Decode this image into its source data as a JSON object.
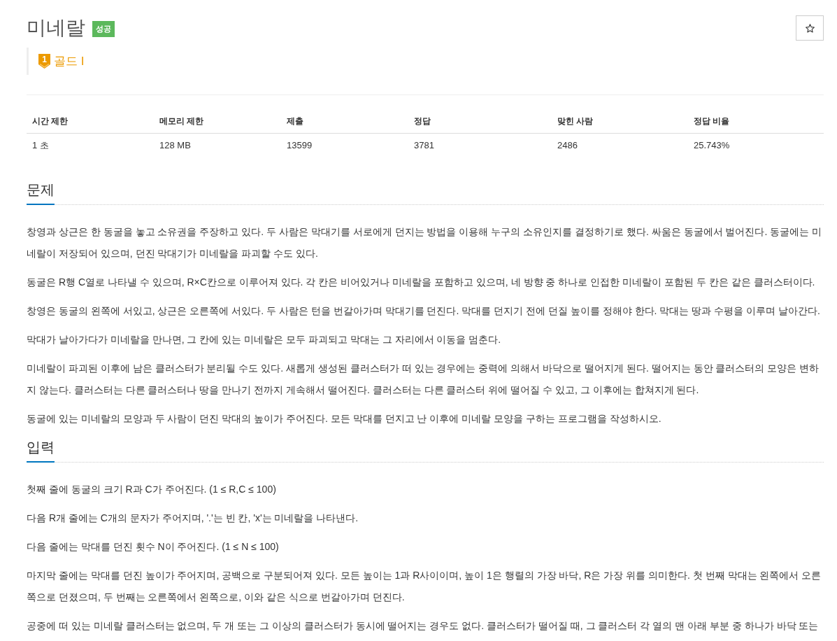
{
  "problem": {
    "title": "미네랄",
    "result_badge": "성공",
    "tier": {
      "badge": "1",
      "label": "골드 I"
    },
    "starred": false
  },
  "stats": {
    "columns": [
      "시간 제한",
      "메모리 제한",
      "제출",
      "정답",
      "맞힌 사람",
      "정답 비율"
    ],
    "rows": [
      [
        "1 초",
        "128 MB",
        "13599",
        "3781",
        "2486",
        "25.743%"
      ]
    ]
  },
  "sections": [
    {
      "heading": "문제",
      "paragraphs": [
        "창영과 상근은 한 동굴을 놓고 소유권을 주장하고 있다. 두 사람은 막대기를 서로에게 던지는 방법을 이용해 누구의 소유인지를 결정하기로 했다. 싸움은 동굴에서 벌어진다. 동굴에는 미네랄이 저장되어 있으며, 던진 막대기가 미네랄을 파괴할 수도 있다.",
        "동굴은 R행 C열로 나타낼 수 있으며, R×C칸으로 이루어져 있다. 각 칸은 비어있거나 미네랄을 포함하고 있으며, 네 방향 중 하나로 인접한 미네랄이 포함된 두 칸은 같은 클러스터이다.",
        "창영은 동굴의 왼쪽에 서있고, 상근은 오른쪽에 서있다. 두 사람은 턴을 번갈아가며 막대기를 던진다. 막대를 던지기 전에 던질 높이를 정해야 한다. 막대는 땅과 수평을 이루며 날아간다.",
        "막대가 날아가다가 미네랄을 만나면, 그 칸에 있는 미네랄은 모두 파괴되고 막대는 그 자리에서 이동을 멈춘다.",
        "미네랄이 파괴된 이후에 남은 클러스터가 분리될 수도 있다. 새롭게 생성된 클러스터가 떠 있는 경우에는 중력에 의해서 바닥으로 떨어지게 된다. 떨어지는 동안 클러스터의 모양은 변하지 않는다. 클러스터는 다른 클러스터나 땅을 만나기 전까지 게속해서 떨어진다. 클러스터는 다른 클러스터 위에 떨어질 수 있고, 그 이후에는 합쳐지게 된다.",
        "동굴에 있는 미네랄의 모양과 두 사람이 던진 막대의 높이가 주어진다. 모든 막대를 던지고 난 이후에 미네랄 모양을 구하는 프로그램을 작성하시오."
      ]
    },
    {
      "heading": "입력",
      "paragraphs": [
        "첫째 줄에 동굴의 크기 R과 C가 주어진다. (1 ≤ R,C ≤ 100)",
        "다음 R개 줄에는 C개의 문자가 주어지며, '.'는 빈 칸, 'x'는 미네랄을 나타낸다.",
        "다음 줄에는 막대를 던진 횟수 N이 주어진다. (1 ≤ N ≤ 100)",
        "마지막 줄에는 막대를 던진 높이가 주어지며, 공백으로 구분되어져 있다. 모든 높이는 1과 R사이이며, 높이 1은 행렬의 가장 바닥, R은 가장 위를 의미한다. 첫 번째 막대는 왼쪽에서 오른쪽으로 던졌으며, 두 번째는 오른쪽에서 왼쪽으로, 이와 같은 식으로 번갈아가며 던진다.",
        "공중에 떠 있는 미네랄 클러스터는 없으며, 두 개 또는 그 이상의 클러스터가 동시에 떨어지는 경우도 없다. 클러스터가 떨어질 때, 그 클러스터 각 열의 맨 아래 부분 중 하나가 바닥 또는"
      ]
    }
  ]
}
